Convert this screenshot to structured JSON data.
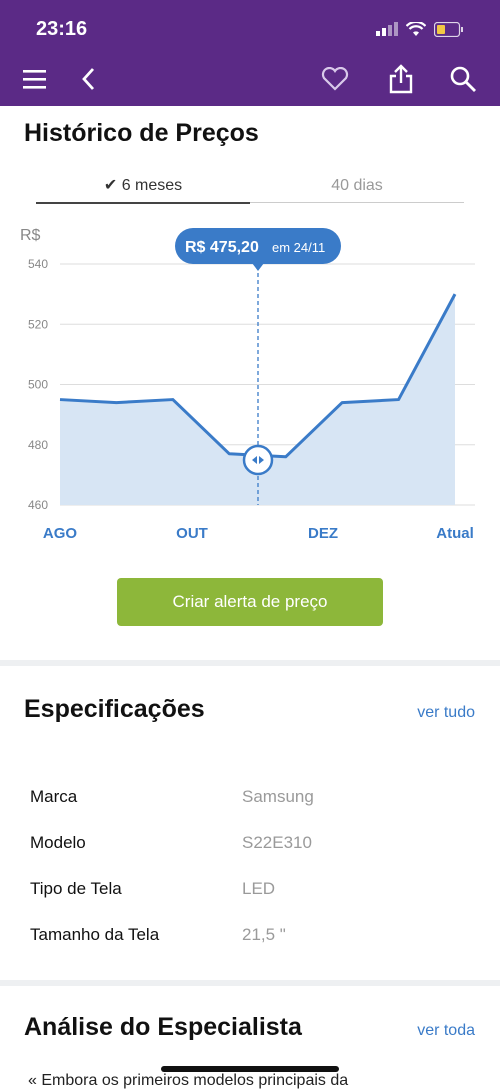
{
  "status": {
    "time": "23:16"
  },
  "header": {
    "icons": [
      "menu-icon",
      "back-icon",
      "heart-icon",
      "share-icon",
      "search-icon"
    ]
  },
  "history": {
    "title": "Histórico de Preços",
    "tabs": [
      {
        "label": "6 meses",
        "active": true
      },
      {
        "label": "40 dias",
        "active": false
      }
    ]
  },
  "chart_data": {
    "type": "area",
    "ylabel": "R$",
    "ylim": [
      460,
      540
    ],
    "yticks": [
      "540",
      "520",
      "500",
      "480",
      "460"
    ],
    "xticklabels": [
      "AGO",
      "OUT",
      "DEZ",
      "Atual"
    ],
    "x": [
      0,
      1,
      2,
      3,
      4,
      5,
      6,
      7
    ],
    "values": [
      495,
      494,
      495,
      477,
      476,
      494,
      495,
      530
    ],
    "tooltip": {
      "price": "R$ 475,20",
      "date": "em 24/11"
    },
    "colors": {
      "line": "#3a7bc8",
      "fill": "#d7e5f4",
      "tooltip": "#3a7bc8"
    }
  },
  "cta": {
    "label": "Criar alerta de preço"
  },
  "specs": {
    "title": "Especificações",
    "link": "ver tudo",
    "rows": [
      {
        "label": "Marca",
        "value": "Samsung"
      },
      {
        "label": "Modelo",
        "value": "S22E310"
      },
      {
        "label": "Tipo de Tela",
        "value": "LED"
      },
      {
        "label": "Tamanho da Tela",
        "value": "21,5 \""
      }
    ]
  },
  "analysis": {
    "title": "Análise do Especialista",
    "link": "ver toda",
    "preview": "« Embora os primeiros modelos principais da"
  },
  "colors": {
    "brand": "#5b2a86",
    "accent": "#3a7bc8",
    "cta": "#8db73a"
  }
}
